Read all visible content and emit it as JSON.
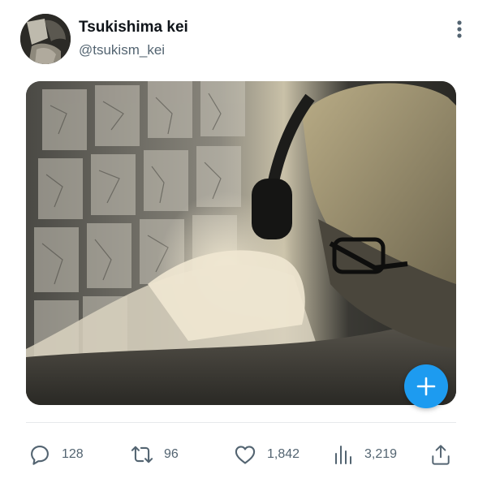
{
  "profile": {
    "display_name": "Tsukishima kei",
    "handle": "@tsukism_kei",
    "avatar_icon": "avatar-photo"
  },
  "header": {
    "more_icon": "more-vertical-icon"
  },
  "media": {
    "fab_icon": "plus-icon",
    "fab_color": "#1d9bf0"
  },
  "actions": {
    "reply": {
      "icon": "reply-icon",
      "count": "128"
    },
    "retweet": {
      "icon": "retweet-icon",
      "count": "96"
    },
    "like": {
      "icon": "heart-icon",
      "count": "1,842"
    },
    "views": {
      "icon": "views-chart-icon",
      "count": "3,219"
    },
    "share": {
      "icon": "share-icon"
    }
  },
  "colors": {
    "text_primary": "#0f1419",
    "text_secondary": "#536471",
    "accent": "#1d9bf0",
    "divider": "#e6e9eb"
  }
}
